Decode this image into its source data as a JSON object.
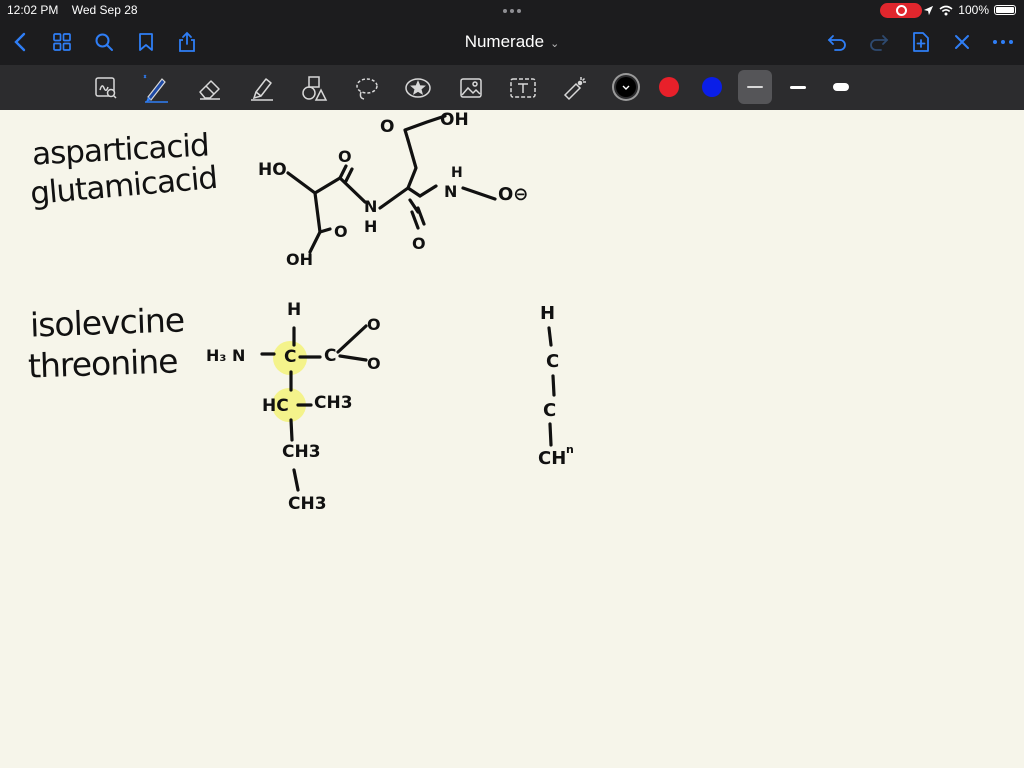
{
  "status_bar": {
    "time": "12:02 PM",
    "date": "Wed Sep 28",
    "battery": "100%"
  },
  "nav": {
    "title": "Numerade",
    "title_chevron": "⌄"
  },
  "colors": {
    "accent": "#2f7ef6",
    "red": "#e8202a",
    "blue": "#0a1ee8",
    "highlight": "#f3f27a",
    "paper": "#f6f5ea"
  },
  "toolbar": {
    "tools": [
      "lasso-zoom",
      "pen",
      "eraser",
      "highlighter",
      "shapes",
      "lasso",
      "elements",
      "image",
      "text",
      "laser-pointer"
    ],
    "swatches": [
      "black",
      "red",
      "blue"
    ],
    "stroke_widths": [
      "thin",
      "medium",
      "thick"
    ]
  },
  "notes": {
    "line1": "asparticacid",
    "line2": "glutamicacid",
    "line3": "isolevcine",
    "line4": "threonine",
    "struct1": {
      "cooh_o": "O",
      "cooh_oh": "OH",
      "ho": "HO",
      "o_top": "O",
      "nh_n": "N",
      "nh_h": "H",
      "o_left": "O",
      "oh_bottom": "OH",
      "o_mid": "O",
      "amide_h": "H",
      "amide_n": "N",
      "o_minus": "O⊖"
    },
    "struct2": {
      "h_top": "H",
      "h3n": "H₃ N",
      "c_alpha": "C",
      "carboxyl_c": "C",
      "o_up": "O",
      "o_down": "O",
      "hc": "HC",
      "ch3_right": "CH3",
      "ch3_mid": "CH3",
      "ch3_bottom": "CH3"
    },
    "struct3": {
      "h": "H",
      "c1": "C",
      "c2": "C",
      "ch": "CH",
      "superscript": "n"
    }
  }
}
